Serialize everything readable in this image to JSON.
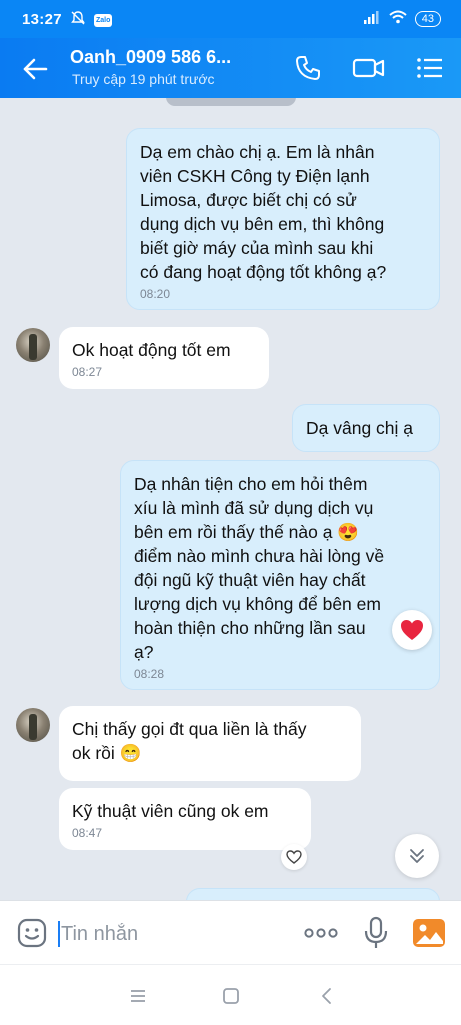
{
  "status_bar": {
    "time": "13:27",
    "zalo_badge": "Zalo",
    "battery": "43",
    "icons": [
      "notifications-off-icon",
      "zalo-icon",
      "signal-icon",
      "wifi-icon",
      "battery-icon"
    ]
  },
  "header": {
    "contact_name": "Oanh_0909 586 6...",
    "last_seen": "Truy cập 19 phút trước",
    "icons": [
      "back-arrow-icon",
      "phone-icon",
      "video-call-icon",
      "menu-list-icon"
    ]
  },
  "chat": {
    "messages": [
      {
        "side": "sent",
        "text": "Dạ em chào chị ạ. Em là nhân\nviên CSKH Công ty Điện lạnh\nLimosa, được biết chị có sử\ndụng dịch vụ bên em, thì không\nbiết giờ máy của mình sau khi\ncó đang hoạt động tốt không ạ?",
        "time": "08:20"
      },
      {
        "side": "received",
        "text": "Ok hoạt động tốt em",
        "time": "08:27"
      },
      {
        "side": "sent",
        "text": "Dạ vâng chị ạ",
        "time": ""
      },
      {
        "side": "sent",
        "text": "Dạ nhân tiện cho em hỏi thêm\nxíu là mình đã sử dụng dịch vụ\nbên em rồi thấy thế nào ạ 😍\nđiểm nào mình chưa hài lòng về\nđội ngũ kỹ thuật viên hay chất\nlượng dịch vụ không để bên em\nhoàn thiện cho những lần sau\nạ?",
        "time": "08:28",
        "reaction": "heart-reaction-icon"
      },
      {
        "side": "received",
        "text": "Chị thấy gọi đt qua liền là thấy\nok rồi 😁",
        "time": ""
      },
      {
        "side": "received",
        "text": "Kỹ thuật viên cũng ok em",
        "time": "08:47"
      }
    ]
  },
  "input_bar": {
    "placeholder": "Tin nhắn",
    "icons": [
      "emoji-sticker-icon",
      "more-options-icon",
      "microphone-icon",
      "image-gallery-icon"
    ]
  },
  "nav_bar": {
    "icons": [
      "recent-apps-icon",
      "home-icon",
      "back-icon"
    ]
  },
  "colors": {
    "header_blue": "#0a86f5",
    "chat_background": "#e3e8ef",
    "sent_bubble": "#d8eefc",
    "received_bubble": "#ffffff",
    "heart_red": "#e8253f"
  }
}
